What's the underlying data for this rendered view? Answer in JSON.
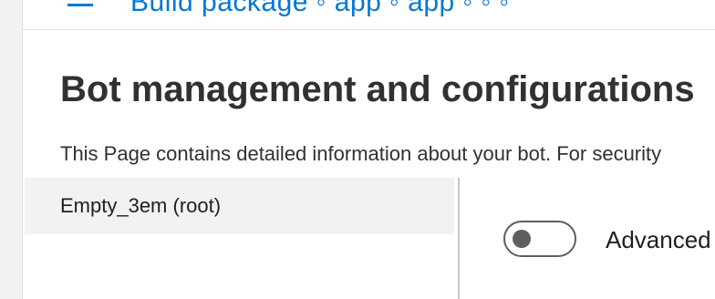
{
  "top_strip": {
    "partial_text": "Build package ◦ app ◦ app ◦ ◦ ◦"
  },
  "page": {
    "title": "Bot management and configurations",
    "description": "This Page contains detailed information about your bot. For security"
  },
  "tree": {
    "items": [
      {
        "label": "Empty_3em (root)",
        "selected": true
      }
    ]
  },
  "settings": {
    "advanced_toggle": {
      "label": "Advanced",
      "on": false
    }
  },
  "colors": {
    "accent": "#0078d4",
    "selected_bg": "#f3f2f1",
    "toggle_off": "#605e5c"
  }
}
